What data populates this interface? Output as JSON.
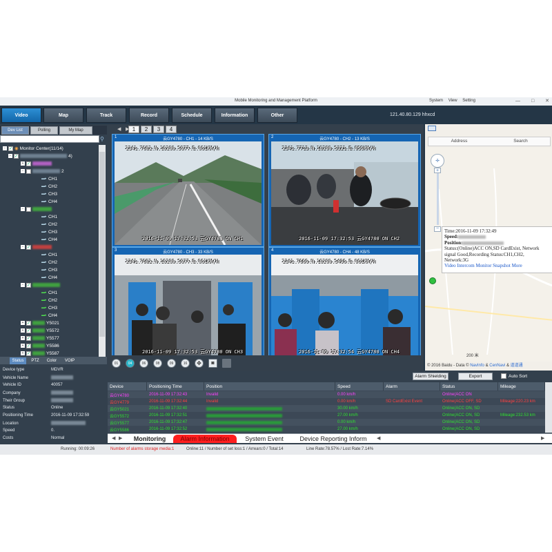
{
  "window": {
    "title": "Mobile Monitoring and Management Platform",
    "menu": [
      "System",
      "View",
      "Setting"
    ],
    "controls": [
      "—",
      "□",
      "✕"
    ]
  },
  "nav": {
    "buttons": [
      "Video",
      "Map",
      "Track",
      "Record",
      "Schedule",
      "Information",
      "Other"
    ],
    "active": "Video",
    "info": "121.40.80.129  hhxcd"
  },
  "left": {
    "tabs": [
      "Dev List",
      "Polling",
      "My Map"
    ],
    "tree": {
      "root": "Monitor Center(11/14)",
      "node_suffix": "4)",
      "node_prefix": "2",
      "channels": [
        "CH1",
        "CH2",
        "CH3",
        "CH4"
      ],
      "dev_labels": [
        "Y5021",
        "Y5572",
        "Y5577",
        "Y5586",
        "Y5587"
      ]
    },
    "status_tabs": [
      "Status",
      "PTZ",
      "Color",
      "VOIP"
    ],
    "status_rows": [
      {
        "label": "Device type",
        "value": "MDVR"
      },
      {
        "label": "Vehicle Name",
        "value": ""
      },
      {
        "label": "Vehicle ID",
        "value": "40057"
      },
      {
        "label": "Company",
        "value": ""
      },
      {
        "label": "Their Group",
        "value": ""
      },
      {
        "label": "Status",
        "value": "Online"
      },
      {
        "label": "Positioning Time",
        "value": "2016-11-09 17:32:59"
      },
      {
        "label": "Location",
        "value": ""
      },
      {
        "label": "Speed",
        "value": "0."
      },
      {
        "label": "Costs",
        "value": "Normal"
      }
    ]
  },
  "video": {
    "tabs": [
      "1",
      "2",
      "3",
      "4"
    ],
    "channels": [
      {
        "num": "1",
        "caption": "云GY4780 - CH1 - 14 KB/S",
        "osd_top": "2341.7682.N.10200.5077.E.061KM/H",
        "osd_bottom": "2016-11-09 17:32:53  云GY4780 ON  CH1"
      },
      {
        "num": "2",
        "caption": "云GY4780 - CH2 - 13 KB/S",
        "osd_top": "2341.7713.N.10200.5321.E.059KM/H",
        "osd_bottom": "2016-11-09 17:32:53  云GY4780 ON  CH2"
      },
      {
        "num": "3",
        "caption": "云GY4780 - CH3 - 33 KB/S",
        "osd_top": "2341.7682.N.10200.5077.E.061KM/H",
        "osd_bottom": "2016-11-09 17:32:53  云GY4780 ON  CH3"
      },
      {
        "num": "4",
        "caption": "云GY4780 - CH4 - 48 KB/S",
        "osd_top": "2341.7669.N.10200.5496.E.061KM/H",
        "osd_bottom": "2016-11-09 17:32:54  云GY4780 ON  CH4"
      }
    ],
    "controls": [
      "01",
      "04",
      "06",
      "08",
      "09",
      "16"
    ]
  },
  "map": {
    "tabs": [
      "Address",
      "Search"
    ],
    "map_type": [
      "地图",
      "卫星"
    ],
    "popup": {
      "time": "Time:2016-11-09 17:32:49",
      "speed": "Speed:",
      "position": "Position:",
      "status": "Status:(Online)ACC ON,SD CardExist, Network signal Good,Recording Status:CH1,CH2,",
      "network": "Network:3G",
      "links": [
        "Video",
        "Intercom",
        "Monitor",
        "Snapshot",
        "More"
      ]
    },
    "scale": "200 米",
    "copyright": "© 2016 Baidu - Data ©",
    "data_links": [
      "NavInfo",
      "&",
      "CenNavi",
      "&",
      "道道通"
    ]
  },
  "toolbar": {
    "alarm_shielding": "Alarm Shielding",
    "export": "Export",
    "auto_sort": "Auto Sort"
  },
  "grid": {
    "headers": [
      "Device",
      "Positioning Time",
      "Position",
      "Speed",
      "Alarm",
      "Status",
      "Mileage"
    ],
    "rows": [
      {
        "device": "云GY4780",
        "time": "2016-11-09 17:32:43",
        "position": "Invalid",
        "speed": "0.00 km/h",
        "alarm": "",
        "status": "Online(ACC ON",
        "mileage": "",
        "color": "#ff40ff"
      },
      {
        "device": "云GY4779",
        "time": "2016-11-09 17:32:44",
        "position": "Invalid",
        "speed": "0.00 km/h",
        "alarm": "SD CardExist Event",
        "status": "Online(ACC OFF, SD",
        "mileage": "Mileage:220.23 km",
        "color": "#ff4040"
      },
      {
        "device": "云GY5021",
        "time": "2016-11-09 17:32:40",
        "position": "",
        "speed": "30.00 km/h",
        "alarm": "",
        "status": "Online(ACC ON, SD",
        "mileage": "",
        "color": "#30e030"
      },
      {
        "device": "云GY5572",
        "time": "2016-11-09 17:32:51",
        "position": "",
        "speed": "27.00 km/h",
        "alarm": "",
        "status": "Online(ACC ON, SD",
        "mileage": "Mileage:232.53 km",
        "color": "#30e030"
      },
      {
        "device": "云GY5577",
        "time": "2016-11-09 17:32:47",
        "position": "",
        "speed": "0.00 km/h",
        "alarm": "",
        "status": "Online(ACC ON, SD",
        "mileage": "",
        "color": "#30e030"
      },
      {
        "device": "云GY5586",
        "time": "2016-11-09 17:32:52",
        "position": "",
        "speed": "27.00 km/h",
        "alarm": "",
        "status": "Online(ACC ON, SD",
        "mileage": "",
        "color": "#30e030"
      }
    ]
  },
  "bottom_tabs": [
    "Monitoring",
    "Alarm Information",
    "System Event",
    "Device Reporting Inform"
  ],
  "statusbar": {
    "running": "Running: 00:09:26",
    "alarms": "Number of alarms storage media:1",
    "online": "Online:11 / Number of set loss:1 / Arrears:0 / Total:14",
    "line_rate": "Line Rate:78.57% / Lost Rate:7.14%"
  },
  "colors": {
    "nav_active": "#1a78c2",
    "panel_bg": "#33404d",
    "video_border": "#1565b3",
    "alarm_tab": "#ff1e1e",
    "row_online": "#30e030"
  }
}
